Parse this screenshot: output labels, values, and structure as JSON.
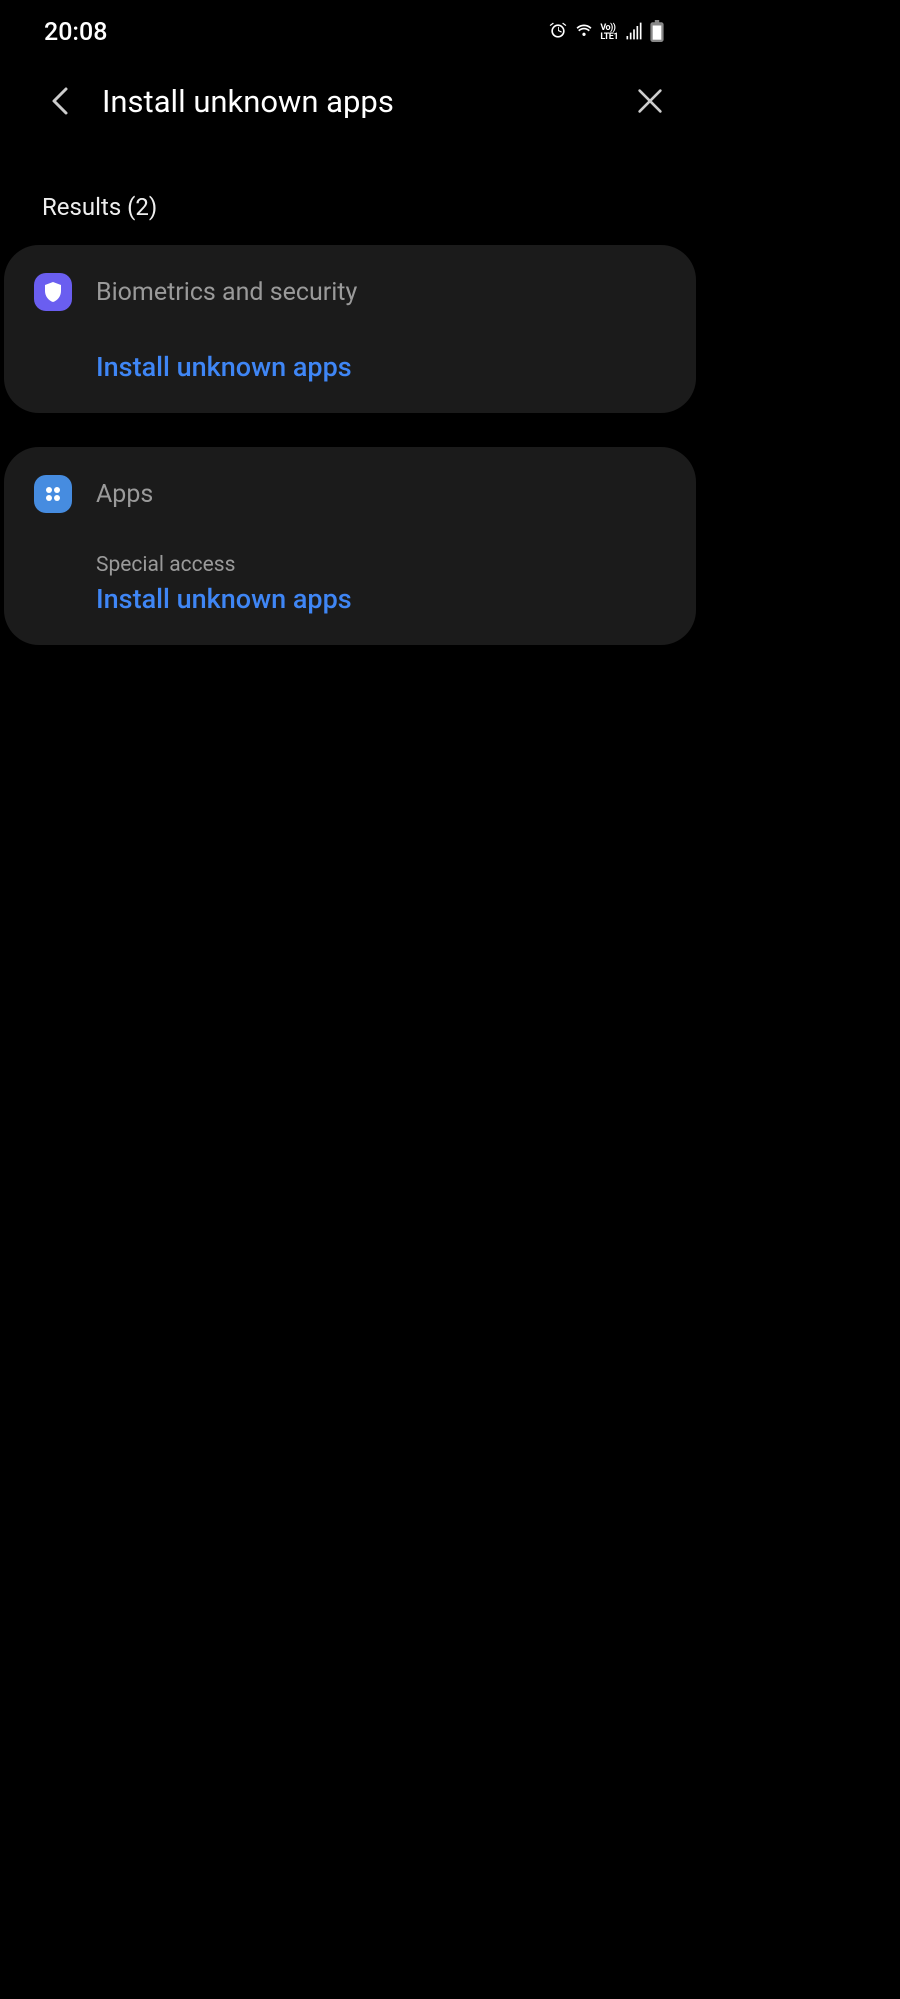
{
  "status": {
    "time": "20:08",
    "network_label": "LTE1"
  },
  "header": {
    "title": "Install unknown apps"
  },
  "results_label": "Results (2)",
  "cards": [
    {
      "category": "Biometrics and security",
      "subcategory": "",
      "link": "Install unknown apps"
    },
    {
      "category": "Apps",
      "subcategory": "Special access",
      "link": "Install unknown apps"
    }
  ]
}
